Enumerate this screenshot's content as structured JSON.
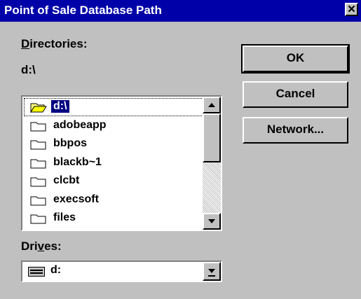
{
  "window": {
    "title": "Point of Sale Database Path",
    "close_glyph": "✕"
  },
  "directories": {
    "label_prefix": "",
    "label_underlined": "D",
    "label_rest": "irectories:",
    "current_path": "d:\\",
    "items": [
      {
        "name": "d:\\",
        "icon": "open-folder-icon",
        "selected": true
      },
      {
        "name": "adobeapp",
        "icon": "folder-icon",
        "selected": false
      },
      {
        "name": "bbpos",
        "icon": "folder-icon",
        "selected": false
      },
      {
        "name": "blackb~1",
        "icon": "folder-icon",
        "selected": false
      },
      {
        "name": "clcbt",
        "icon": "folder-icon",
        "selected": false
      },
      {
        "name": "execsoft",
        "icon": "folder-icon",
        "selected": false
      },
      {
        "name": "files",
        "icon": "folder-icon",
        "selected": false
      }
    ]
  },
  "drives": {
    "label_prefix": "Dri",
    "label_underlined": "v",
    "label_rest": "es:",
    "selected": "d:",
    "icon": "drive-icon"
  },
  "buttons": {
    "ok": "OK",
    "cancel": "Cancel",
    "network": "Network..."
  },
  "colors": {
    "title_bar": "#0000a8",
    "dialog_bg": "#c0c0c0",
    "selection": "#000080"
  }
}
